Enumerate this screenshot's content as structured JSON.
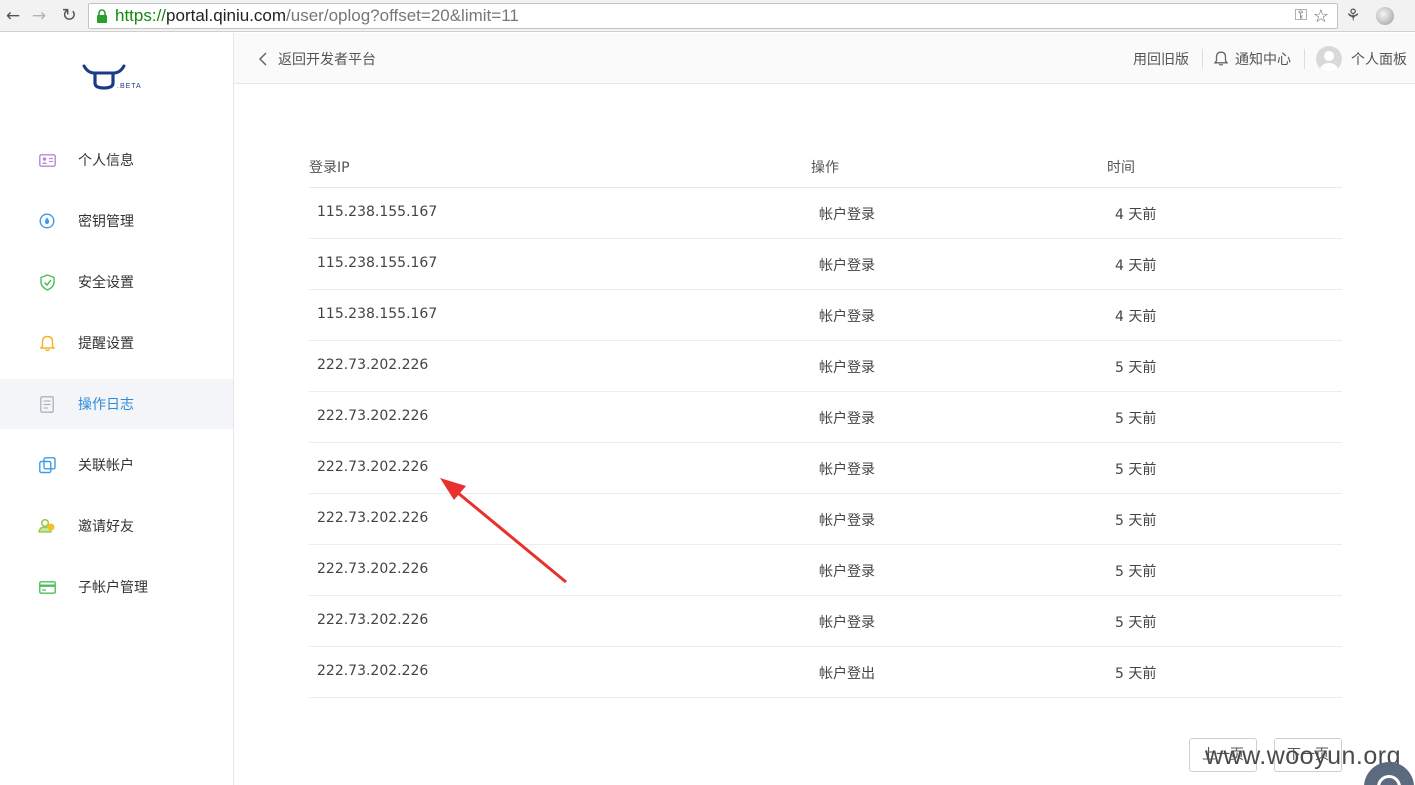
{
  "browser": {
    "url_scheme": "https://",
    "url_host": "portal.qiniu.com",
    "url_path": "/user/oplog?offset=20&limit=11"
  },
  "logo": {
    "badge": ".BETA"
  },
  "sidebar": {
    "items": [
      {
        "label": "个人信息",
        "icon": "id-card-icon",
        "color": "#b58ad6"
      },
      {
        "label": "密钥管理",
        "icon": "key-drop-icon",
        "color": "#3d9be9"
      },
      {
        "label": "安全设置",
        "icon": "shield-check-icon",
        "color": "#4cbf5a"
      },
      {
        "label": "提醒设置",
        "icon": "bell-icon",
        "color": "#f5b324"
      },
      {
        "label": "操作日志",
        "icon": "document-icon",
        "color": "#a9b3bd",
        "active": true
      },
      {
        "label": "关联帐户",
        "icon": "linked-squares-icon",
        "color": "#3d9be9"
      },
      {
        "label": "邀请好友",
        "icon": "friends-icon",
        "color": "#8cc63f"
      },
      {
        "label": "子帐户管理",
        "icon": "card-icon",
        "color": "#4cbf5a"
      }
    ]
  },
  "header": {
    "back_label": "返回开发者平台",
    "old_version": "用回旧版",
    "notifications": "通知中心",
    "personal_panel": "个人面板"
  },
  "table": {
    "columns": [
      "登录IP",
      "操作",
      "时间"
    ],
    "rows": [
      {
        "ip": "115.238.155.167",
        "op": "帐户登录",
        "time": "4 天前"
      },
      {
        "ip": "115.238.155.167",
        "op": "帐户登录",
        "time": "4 天前"
      },
      {
        "ip": "115.238.155.167",
        "op": "帐户登录",
        "time": "4 天前"
      },
      {
        "ip": "222.73.202.226",
        "op": "帐户登录",
        "time": "5 天前"
      },
      {
        "ip": "222.73.202.226",
        "op": "帐户登录",
        "time": "5 天前"
      },
      {
        "ip": "222.73.202.226",
        "op": "帐户登录",
        "time": "5 天前"
      },
      {
        "ip": "222.73.202.226",
        "op": "帐户登录",
        "time": "5 天前"
      },
      {
        "ip": "222.73.202.226",
        "op": "帐户登录",
        "time": "5 天前"
      },
      {
        "ip": "222.73.202.226",
        "op": "帐户登录",
        "time": "5 天前"
      },
      {
        "ip": "222.73.202.226",
        "op": "帐户登出",
        "time": "5 天前"
      }
    ]
  },
  "pagination": {
    "prev": "上一页",
    "next": "下一页"
  },
  "watermark": "www.wooyun.org",
  "colors": {
    "accent": "#2e8bdb",
    "annotation_arrow": "#e8302f"
  }
}
